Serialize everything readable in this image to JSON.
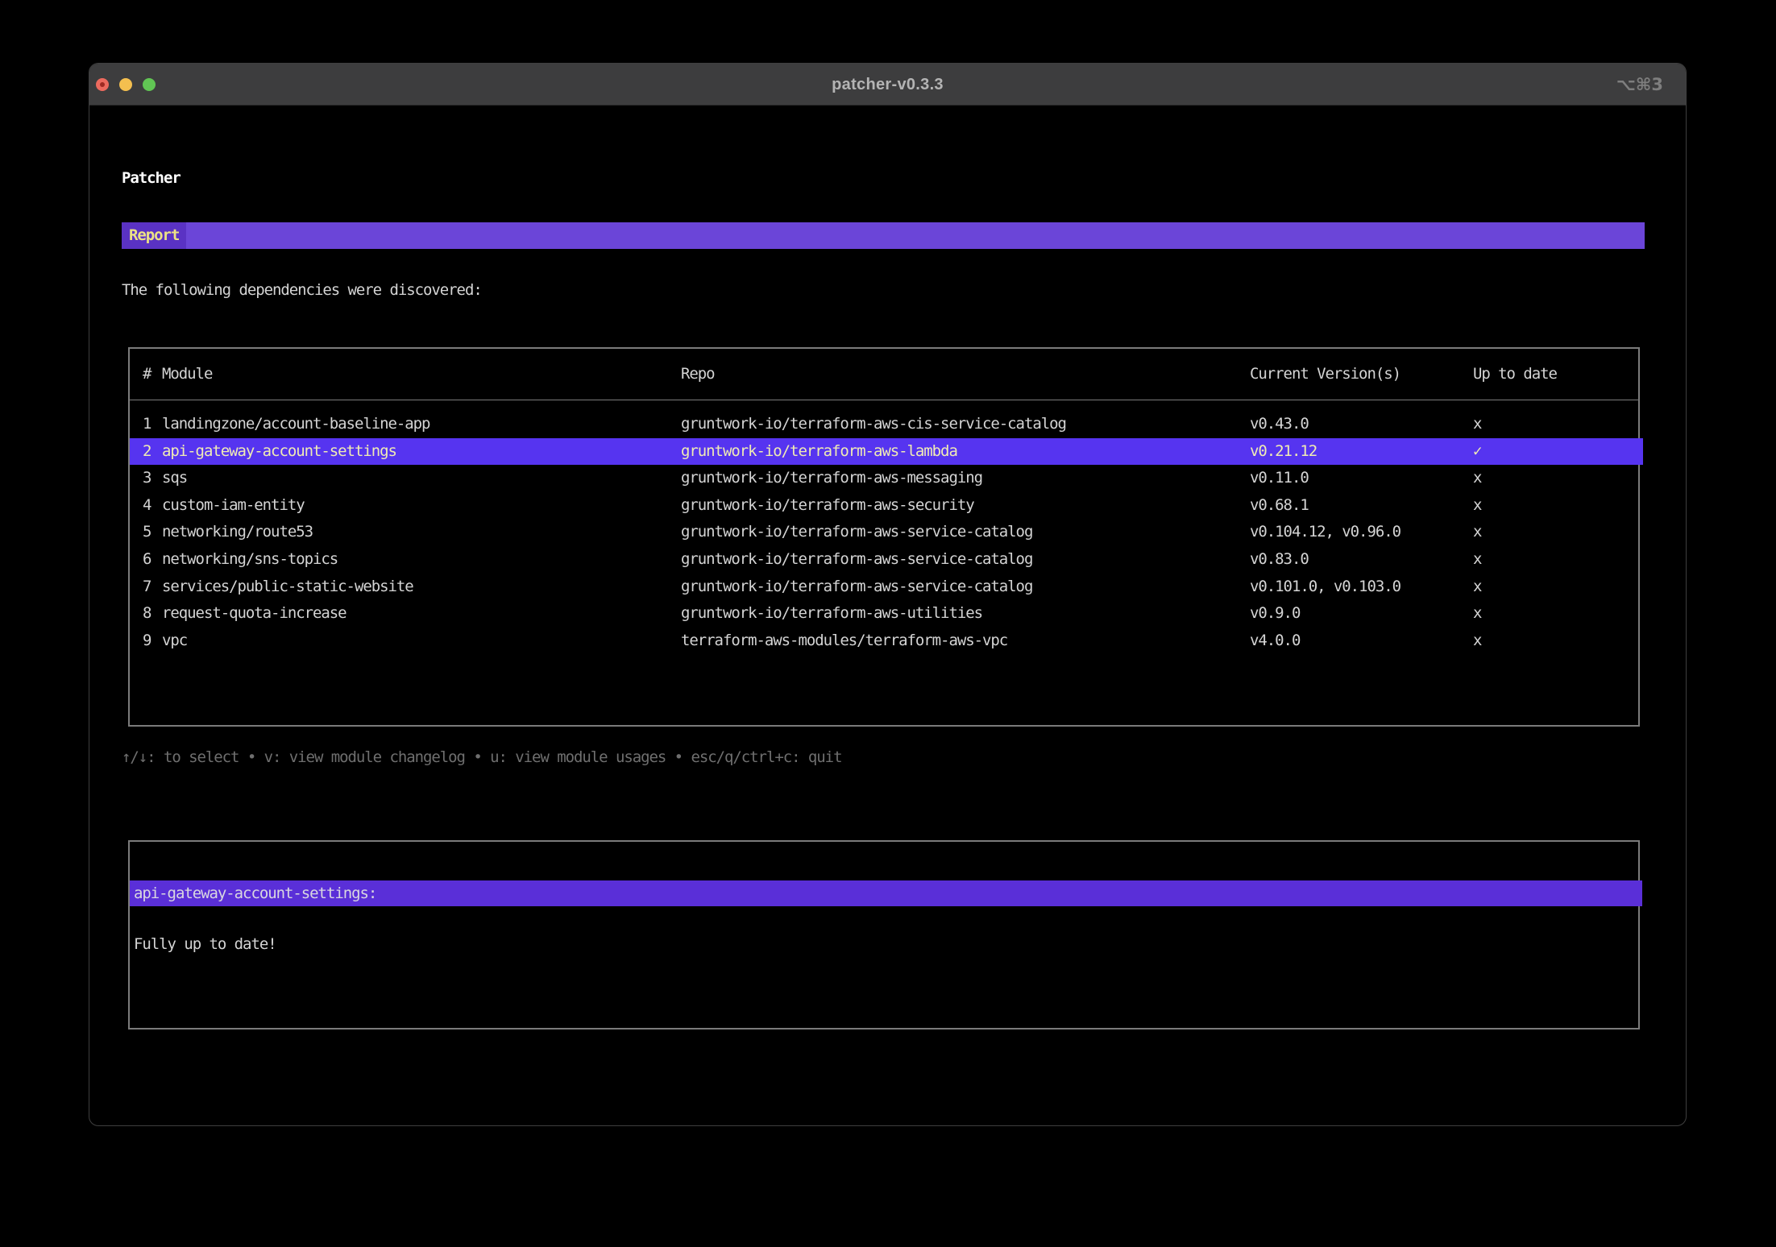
{
  "window": {
    "title": "patcher-v0.3.3",
    "shortcut": "⌥⌘3"
  },
  "app": {
    "heading": "Patcher",
    "tab_label": "Report",
    "intro": "The following dependencies were discovered:",
    "help": "↑/↓: to select • v: view module changelog • u: view module usages • esc/q/ctrl+c: quit"
  },
  "table": {
    "columns": [
      "#",
      "Module",
      "Repo",
      "Current Version(s)",
      "Up to date"
    ],
    "rows": [
      {
        "num": "1",
        "module": "landingzone/account-baseline-app",
        "repo": "gruntwork-io/terraform-aws-cis-service-catalog",
        "versions": "v0.43.0",
        "up_to_date": "x",
        "selected": false
      },
      {
        "num": "2",
        "module": "api-gateway-account-settings",
        "repo": "gruntwork-io/terraform-aws-lambda",
        "versions": "v0.21.12",
        "up_to_date": "✓",
        "selected": true
      },
      {
        "num": "3",
        "module": "sqs",
        "repo": "gruntwork-io/terraform-aws-messaging",
        "versions": "v0.11.0",
        "up_to_date": "x",
        "selected": false
      },
      {
        "num": "4",
        "module": "custom-iam-entity",
        "repo": "gruntwork-io/terraform-aws-security",
        "versions": "v0.68.1",
        "up_to_date": "x",
        "selected": false
      },
      {
        "num": "5",
        "module": "networking/route53",
        "repo": "gruntwork-io/terraform-aws-service-catalog",
        "versions": "v0.104.12, v0.96.0",
        "up_to_date": "x",
        "selected": false
      },
      {
        "num": "6",
        "module": "networking/sns-topics",
        "repo": "gruntwork-io/terraform-aws-service-catalog",
        "versions": "v0.83.0",
        "up_to_date": "x",
        "selected": false
      },
      {
        "num": "7",
        "module": "services/public-static-website",
        "repo": "gruntwork-io/terraform-aws-service-catalog",
        "versions": "v0.101.0, v0.103.0",
        "up_to_date": "x",
        "selected": false
      },
      {
        "num": "8",
        "module": "request-quota-increase",
        "repo": "gruntwork-io/terraform-aws-utilities",
        "versions": "v0.9.0",
        "up_to_date": "x",
        "selected": false
      },
      {
        "num": "9",
        "module": "vpc",
        "repo": "terraform-aws-modules/terraform-aws-vpc",
        "versions": "v4.0.0",
        "up_to_date": "x",
        "selected": false
      }
    ]
  },
  "detail": {
    "title": "api-gateway-account-settings:",
    "body": "Fully up to date!"
  },
  "colors": {
    "banner_bg": "#6b45d8",
    "tab_bg": "#5a32c4",
    "tab_text": "#ece285",
    "selected_row_bg": "#5634f0",
    "selected_row_text": "#f0ebb4",
    "detail_bar_bg": "#5a2fd8",
    "text": "#d4d4d4",
    "muted_text": "#6f6f6f",
    "border": "#7b7b7b",
    "traffic_red": "#ec6a5e",
    "traffic_yellow": "#f4bf4f",
    "traffic_green": "#61c554"
  }
}
